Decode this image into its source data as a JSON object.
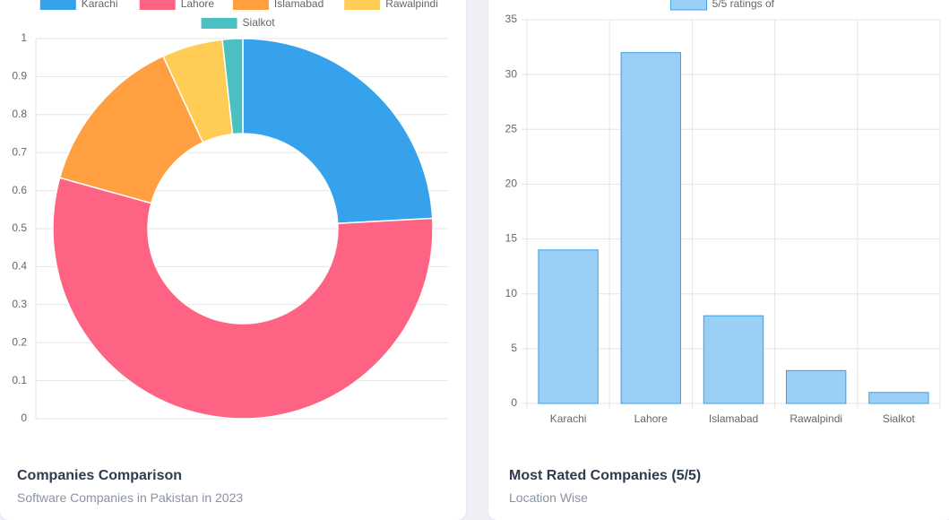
{
  "doughnut_card": {
    "title": "Companies Comparison",
    "subtitle": "Software Companies in Pakistan in 2023"
  },
  "bar_card": {
    "title": "Most Rated Companies (5/5)",
    "subtitle": "Location Wise"
  },
  "chart_data": [
    {
      "type": "pie",
      "variant": "doughnut",
      "categories": [
        "Karachi",
        "Lahore",
        "Islamabad",
        "Rawalpindi",
        "Sialkot"
      ],
      "values": [
        14,
        32,
        8,
        3,
        1
      ],
      "colors": [
        "#36a2eb",
        "#ff6384",
        "#ff9f40",
        "#ffcd56",
        "#4bc0c0"
      ],
      "legend": "top",
      "y_ticks": [
        "0",
        "0.1",
        "0.2",
        "0.3",
        "0.4",
        "0.5",
        "0.6",
        "0.7",
        "0.8",
        "0.9",
        "1"
      ],
      "ylim": [
        0,
        1
      ],
      "grid": true
    },
    {
      "type": "bar",
      "categories": [
        "Karachi",
        "Lahore",
        "Islamabad",
        "Rawalpindi",
        "Sialkot"
      ],
      "series": [
        {
          "name": "5/5 ratings of",
          "values": [
            14,
            32,
            8,
            3,
            1
          ]
        }
      ],
      "ylim": [
        0,
        35
      ],
      "y_ticks": [
        "0",
        "5",
        "10",
        "15",
        "20",
        "25",
        "30",
        "35"
      ],
      "legend": "top",
      "grid": true,
      "bar_color": "#9ad0f5",
      "bar_border": "#36a2eb"
    }
  ]
}
